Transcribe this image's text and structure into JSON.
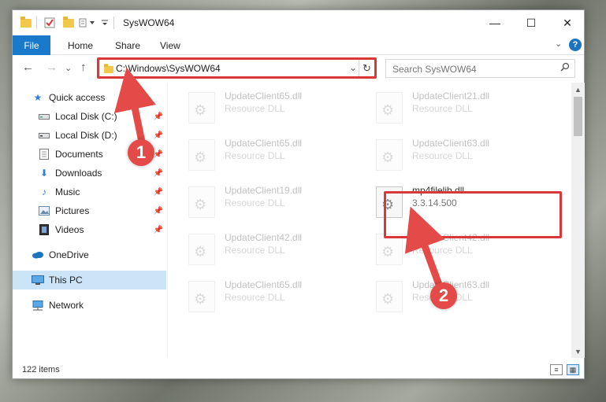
{
  "window": {
    "title": "SysWOW64",
    "minimize": "—",
    "maximize": "☐",
    "close": "✕"
  },
  "ribbon": {
    "tabs": [
      "File",
      "Home",
      "Share",
      "View"
    ],
    "expand": "⌄",
    "help": "?"
  },
  "address_bar": {
    "path": "C:\\Windows\\SysWOW64",
    "refresh": "↻",
    "dropdown": "⌄"
  },
  "search": {
    "placeholder": "Search SysWOW64"
  },
  "navigation": {
    "back": "←",
    "forward": "→",
    "recent": "⌄",
    "up": "↑"
  },
  "nav_pane": {
    "items": [
      {
        "label": "Quick access",
        "icon": "star-icon"
      },
      {
        "label": "Local Disk (C:)",
        "icon": "drive-icon",
        "pinned": true
      },
      {
        "label": "Local Disk (D:)",
        "icon": "drive-icon",
        "pinned": true
      },
      {
        "label": "Documents",
        "icon": "documents-icon",
        "pinned": true
      },
      {
        "label": "Downloads",
        "icon": "downloads-icon",
        "pinned": true
      },
      {
        "label": "Music",
        "icon": "music-icon",
        "pinned": true
      },
      {
        "label": "Pictures",
        "icon": "pictures-icon",
        "pinned": true
      },
      {
        "label": "Videos",
        "icon": "videos-icon",
        "pinned": true
      },
      {
        "label": "OneDrive",
        "icon": "cloud-icon"
      },
      {
        "label": "This PC",
        "icon": "computer-icon",
        "selected": true
      },
      {
        "label": "Network",
        "icon": "network-icon"
      }
    ]
  },
  "files": [
    {
      "name": "UpdateClient65.dll",
      "type": "Resource DLL"
    },
    {
      "name": "UpdateClient21.dll",
      "type": "Resource DLL"
    },
    {
      "name": "UpdateClient65.dll",
      "type": "Resource DLL"
    },
    {
      "name": "UpdateClient63.dll",
      "type": "Resource DLL"
    },
    {
      "name": "UpdateClient19.dll",
      "type": "Resource DLL"
    },
    {
      "name": "mp4filelib.dll",
      "type": "3.3.14.500",
      "highlighted": true
    },
    {
      "name": "UpdateClient42.dll",
      "type": "Resource DLL"
    },
    {
      "name": "UpdateClient42.dll",
      "type": "Resource DLL"
    },
    {
      "name": "UpdateClient65.dll",
      "type": "Resource DLL"
    },
    {
      "name": "UpdateClient63.dll",
      "type": "Resource DLL"
    }
  ],
  "status": {
    "count": "122 items"
  },
  "callouts": [
    "1",
    "2"
  ],
  "colors": {
    "accent": "#1979ca",
    "highlight": "#d9383a",
    "callout": "#e34a48",
    "selection": "#cce4f7"
  }
}
